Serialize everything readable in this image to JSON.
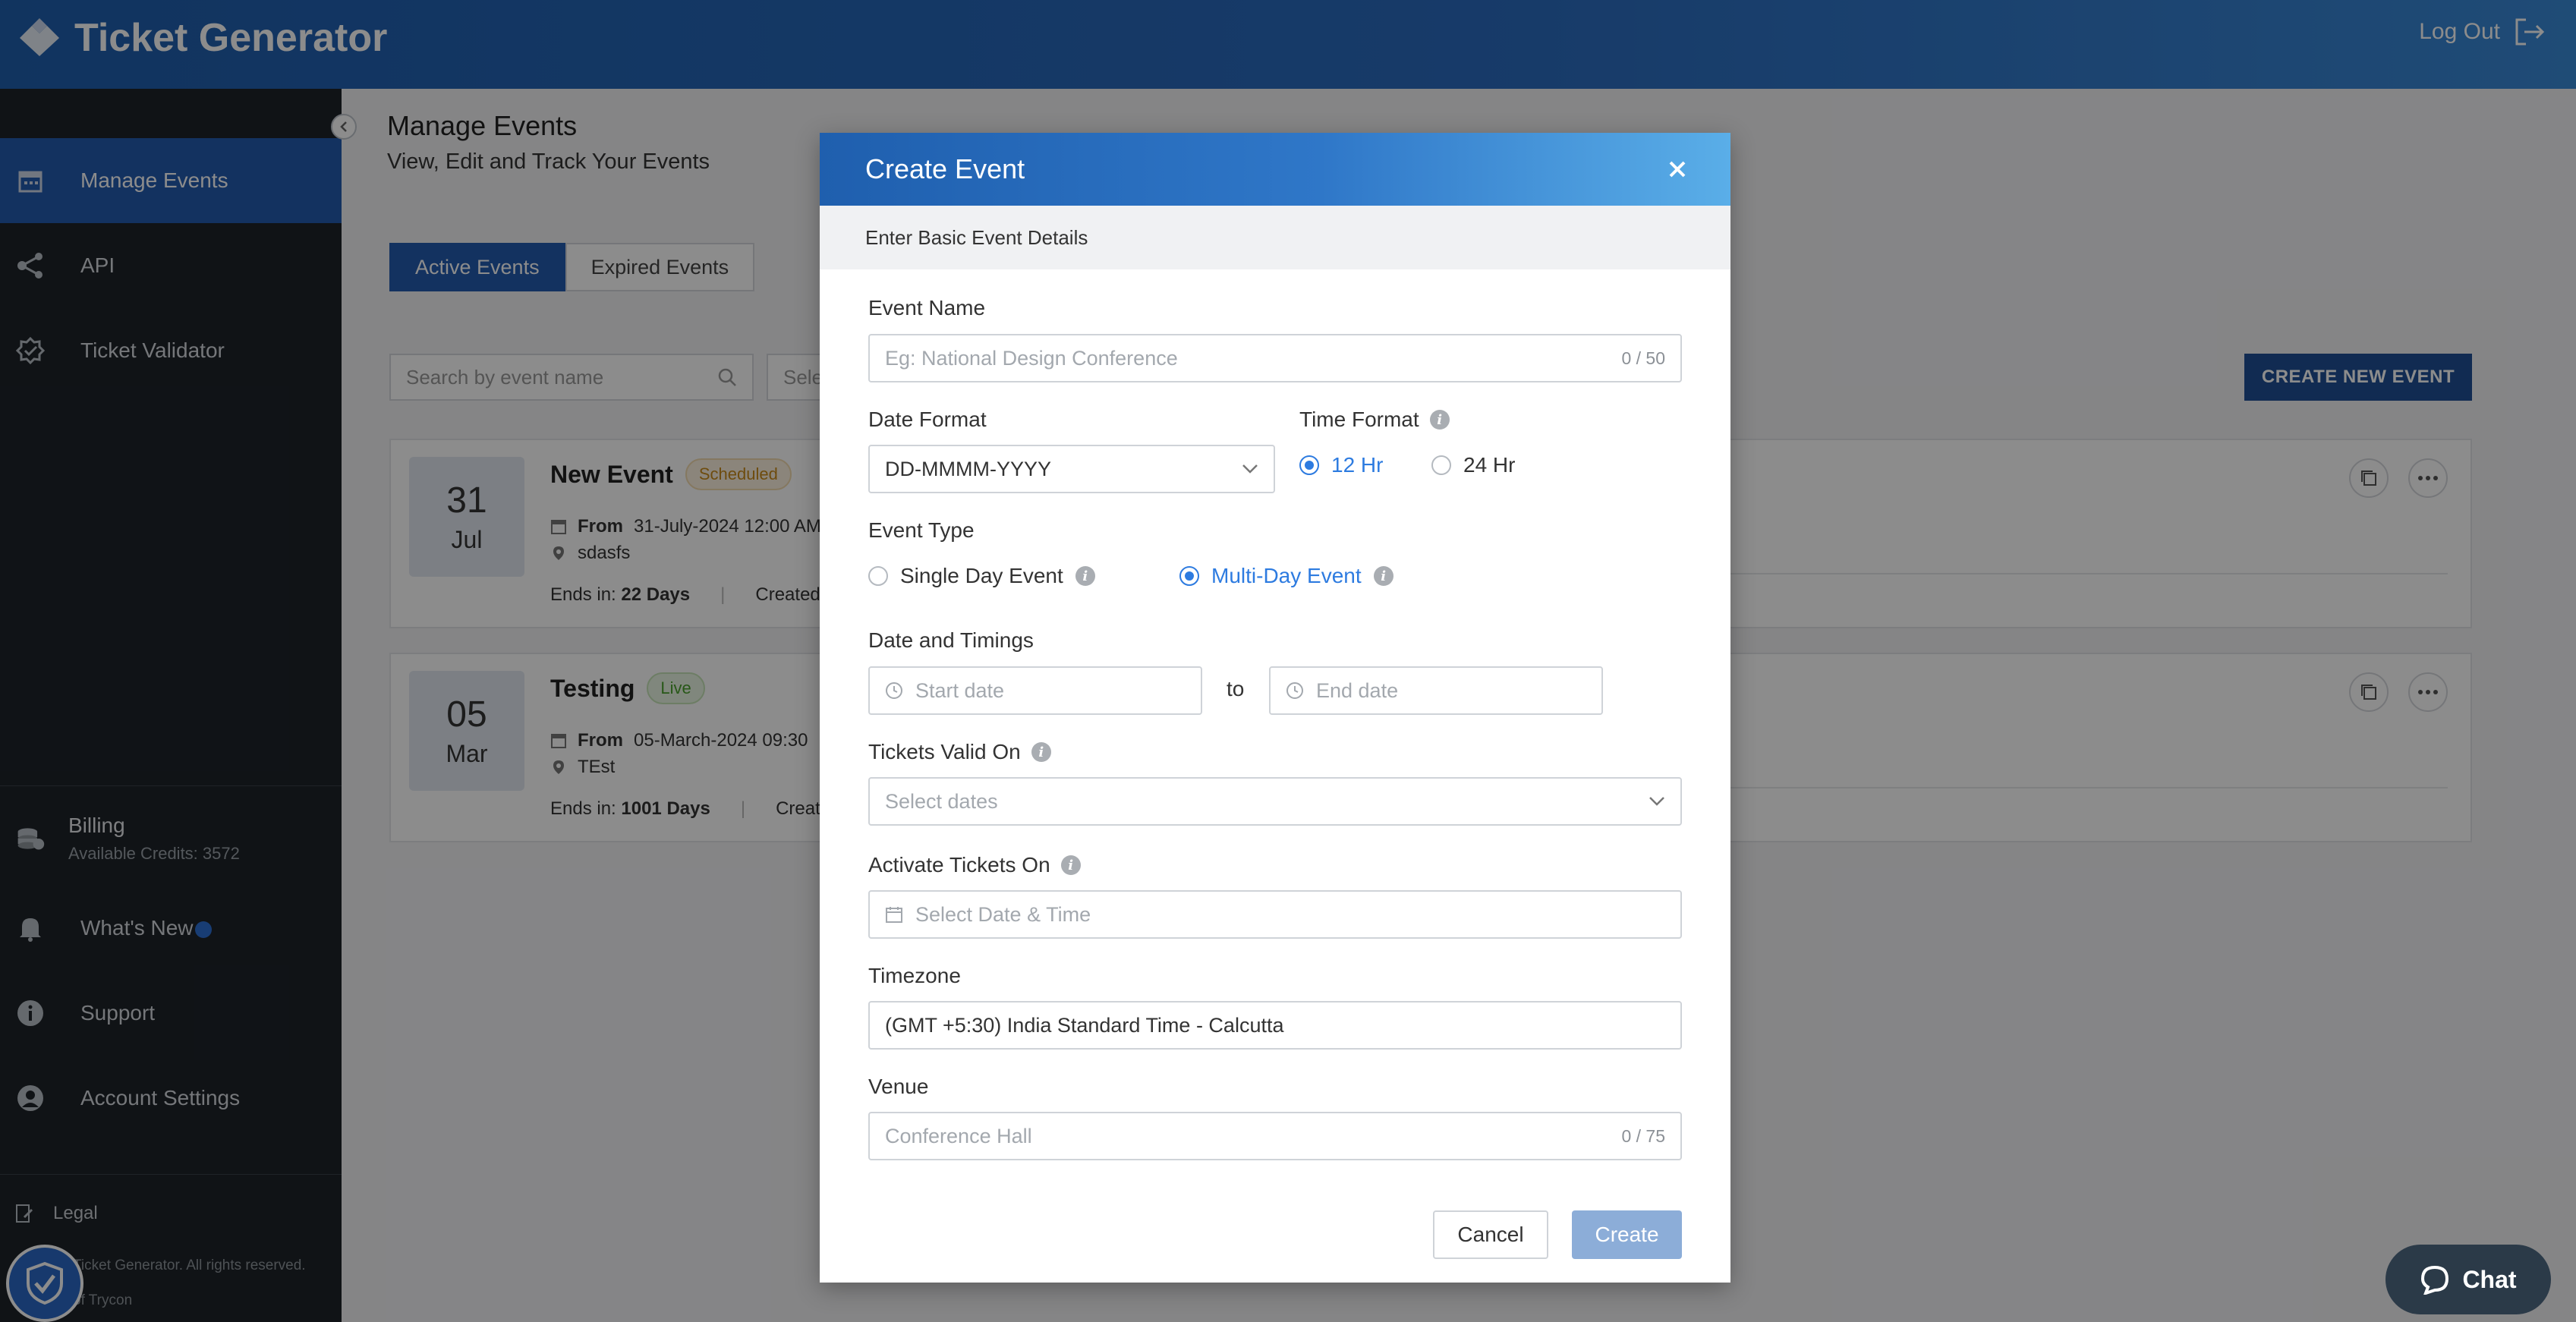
{
  "header": {
    "brand": "Ticket Generator",
    "logout_label": "Log Out"
  },
  "sidebar": {
    "items": [
      {
        "label": "Manage Events",
        "icon": "calendar-icon"
      },
      {
        "label": "API",
        "icon": "share-icon"
      },
      {
        "label": "Ticket Validator",
        "icon": "badge-check-icon"
      }
    ],
    "billing": {
      "title": "Billing",
      "credits": "Available Credits: 3572"
    },
    "whats_new": "What's New",
    "support": "Support",
    "account_settings": "Account Settings",
    "legal": "Legal",
    "copyright": "Ticket Generator. All rights reserved.",
    "copyright_2": "of Trycon"
  },
  "main": {
    "title": "Manage Events",
    "subtitle": "View, Edit and Track Your Events",
    "tabs": [
      {
        "label": "Active Events",
        "active": true
      },
      {
        "label": "Expired Events",
        "active": false
      }
    ],
    "search_placeholder": "Search by event name",
    "select_partial": "Sele",
    "create_new_label": "CREATE NEW EVENT",
    "events": [
      {
        "day": "31",
        "month": "Jul",
        "name": "New Event",
        "status": "Scheduled",
        "from_label": "From",
        "from_value": "31-July-2024 12:00 AM",
        "venue": "sdasfs",
        "ends_label": "Ends in:",
        "ends_value": "22 Days",
        "created": "Created C"
      },
      {
        "day": "05",
        "month": "Mar",
        "name": "Testing",
        "status": "Live",
        "from_label": "From",
        "from_value": "05-March-2024 09:30 ",
        "venue": "TEst",
        "ends_label": "Ends in:",
        "ends_value": "1001 Days",
        "created": "Create"
      }
    ]
  },
  "modal": {
    "title": "Create Event",
    "section": "Enter Basic Event Details",
    "event_name_label": "Event Name",
    "event_name_placeholder": "Eg: National Design Conference",
    "event_name_count": "0 / 50",
    "date_format_label": "Date Format",
    "date_format_value": "DD-MMMM-YYYY",
    "time_format_label": "Time Format",
    "time_options": [
      {
        "label": "12 Hr",
        "selected": true
      },
      {
        "label": "24 Hr",
        "selected": false
      }
    ],
    "event_type_label": "Event Type",
    "event_types": [
      {
        "label": "Single Day Event",
        "selected": false
      },
      {
        "label": "Multi-Day Event",
        "selected": true
      }
    ],
    "date_timings_label": "Date and Timings",
    "start_placeholder": "Start date",
    "to_label": "to",
    "end_placeholder": "End date",
    "tickets_valid_label": "Tickets Valid On",
    "tickets_valid_placeholder": "Select dates",
    "activate_label": "Activate Tickets On",
    "activate_placeholder": "Select Date & Time",
    "timezone_label": "Timezone",
    "timezone_value": "(GMT +5:30) India Standard Time - Calcutta",
    "venue_label": "Venue",
    "venue_placeholder": "Conference Hall",
    "venue_count": "0 / 75",
    "cancel_label": "Cancel",
    "create_label": "Create"
  },
  "chat_label": "Chat",
  "colors": {
    "primary": "#245bb0",
    "accent_radio": "#2d7be0",
    "sidebar_bg": "#1e2329"
  }
}
